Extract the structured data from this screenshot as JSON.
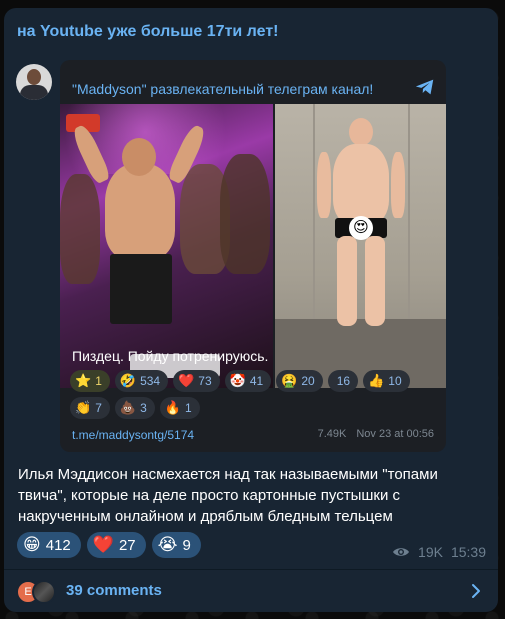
{
  "post": {
    "title": "на Youtube уже больше 17ти лет!",
    "forwarded": {
      "channel_name": "\"Maddyson\" развлекательный телеграм канал!",
      "caption": "Пиздец. Пойду потренируюсь.",
      "reactions_row1": [
        {
          "icon": "star-icon",
          "emoji": "⭐",
          "count": "1",
          "selected": true
        },
        {
          "icon": "rofl-icon",
          "emoji": "🤣",
          "count": "534"
        },
        {
          "icon": "heart-icon",
          "emoji": "❤️",
          "count": "73"
        },
        {
          "icon": "clown-icon",
          "emoji": "🤡",
          "count": "41"
        },
        {
          "icon": "nauseated-icon",
          "emoji": "🤮",
          "count": "20"
        },
        {
          "icon": "blank-reaction-icon",
          "emoji": "",
          "count": "16"
        },
        {
          "icon": "thumbs-up-icon",
          "emoji": "👍",
          "count": "10"
        }
      ],
      "reactions_row2": [
        {
          "icon": "clap-icon",
          "emoji": "👏",
          "count": "7"
        },
        {
          "icon": "poop-icon",
          "emoji": "💩",
          "count": "3"
        },
        {
          "icon": "fire-icon",
          "emoji": "🔥",
          "count": "1"
        }
      ],
      "link": "t.me/maddysontg/5174",
      "views": "7.49K",
      "date": "Nov 23 at 00:56"
    },
    "text": "Илья Мэддисон насмехается над так называемыми \"топами твича\", которые на деле просто картонные пустышки с накрученным онлайном и дряблым бледным тельцем",
    "reactions": [
      {
        "icon": "grin-icon",
        "emoji": "😁",
        "count": "412"
      },
      {
        "icon": "heart-icon",
        "emoji": "❤️",
        "count": "27"
      },
      {
        "icon": "crying-icon",
        "emoji": "😭",
        "count": "9"
      }
    ],
    "views": "19K",
    "time": "15:39",
    "comments": {
      "label": "39 comments",
      "avatar_letter": "E"
    }
  },
  "colors": {
    "accent": "#6ab3f3",
    "bubble": "#182533",
    "reaction_pill": "#2b5278"
  }
}
